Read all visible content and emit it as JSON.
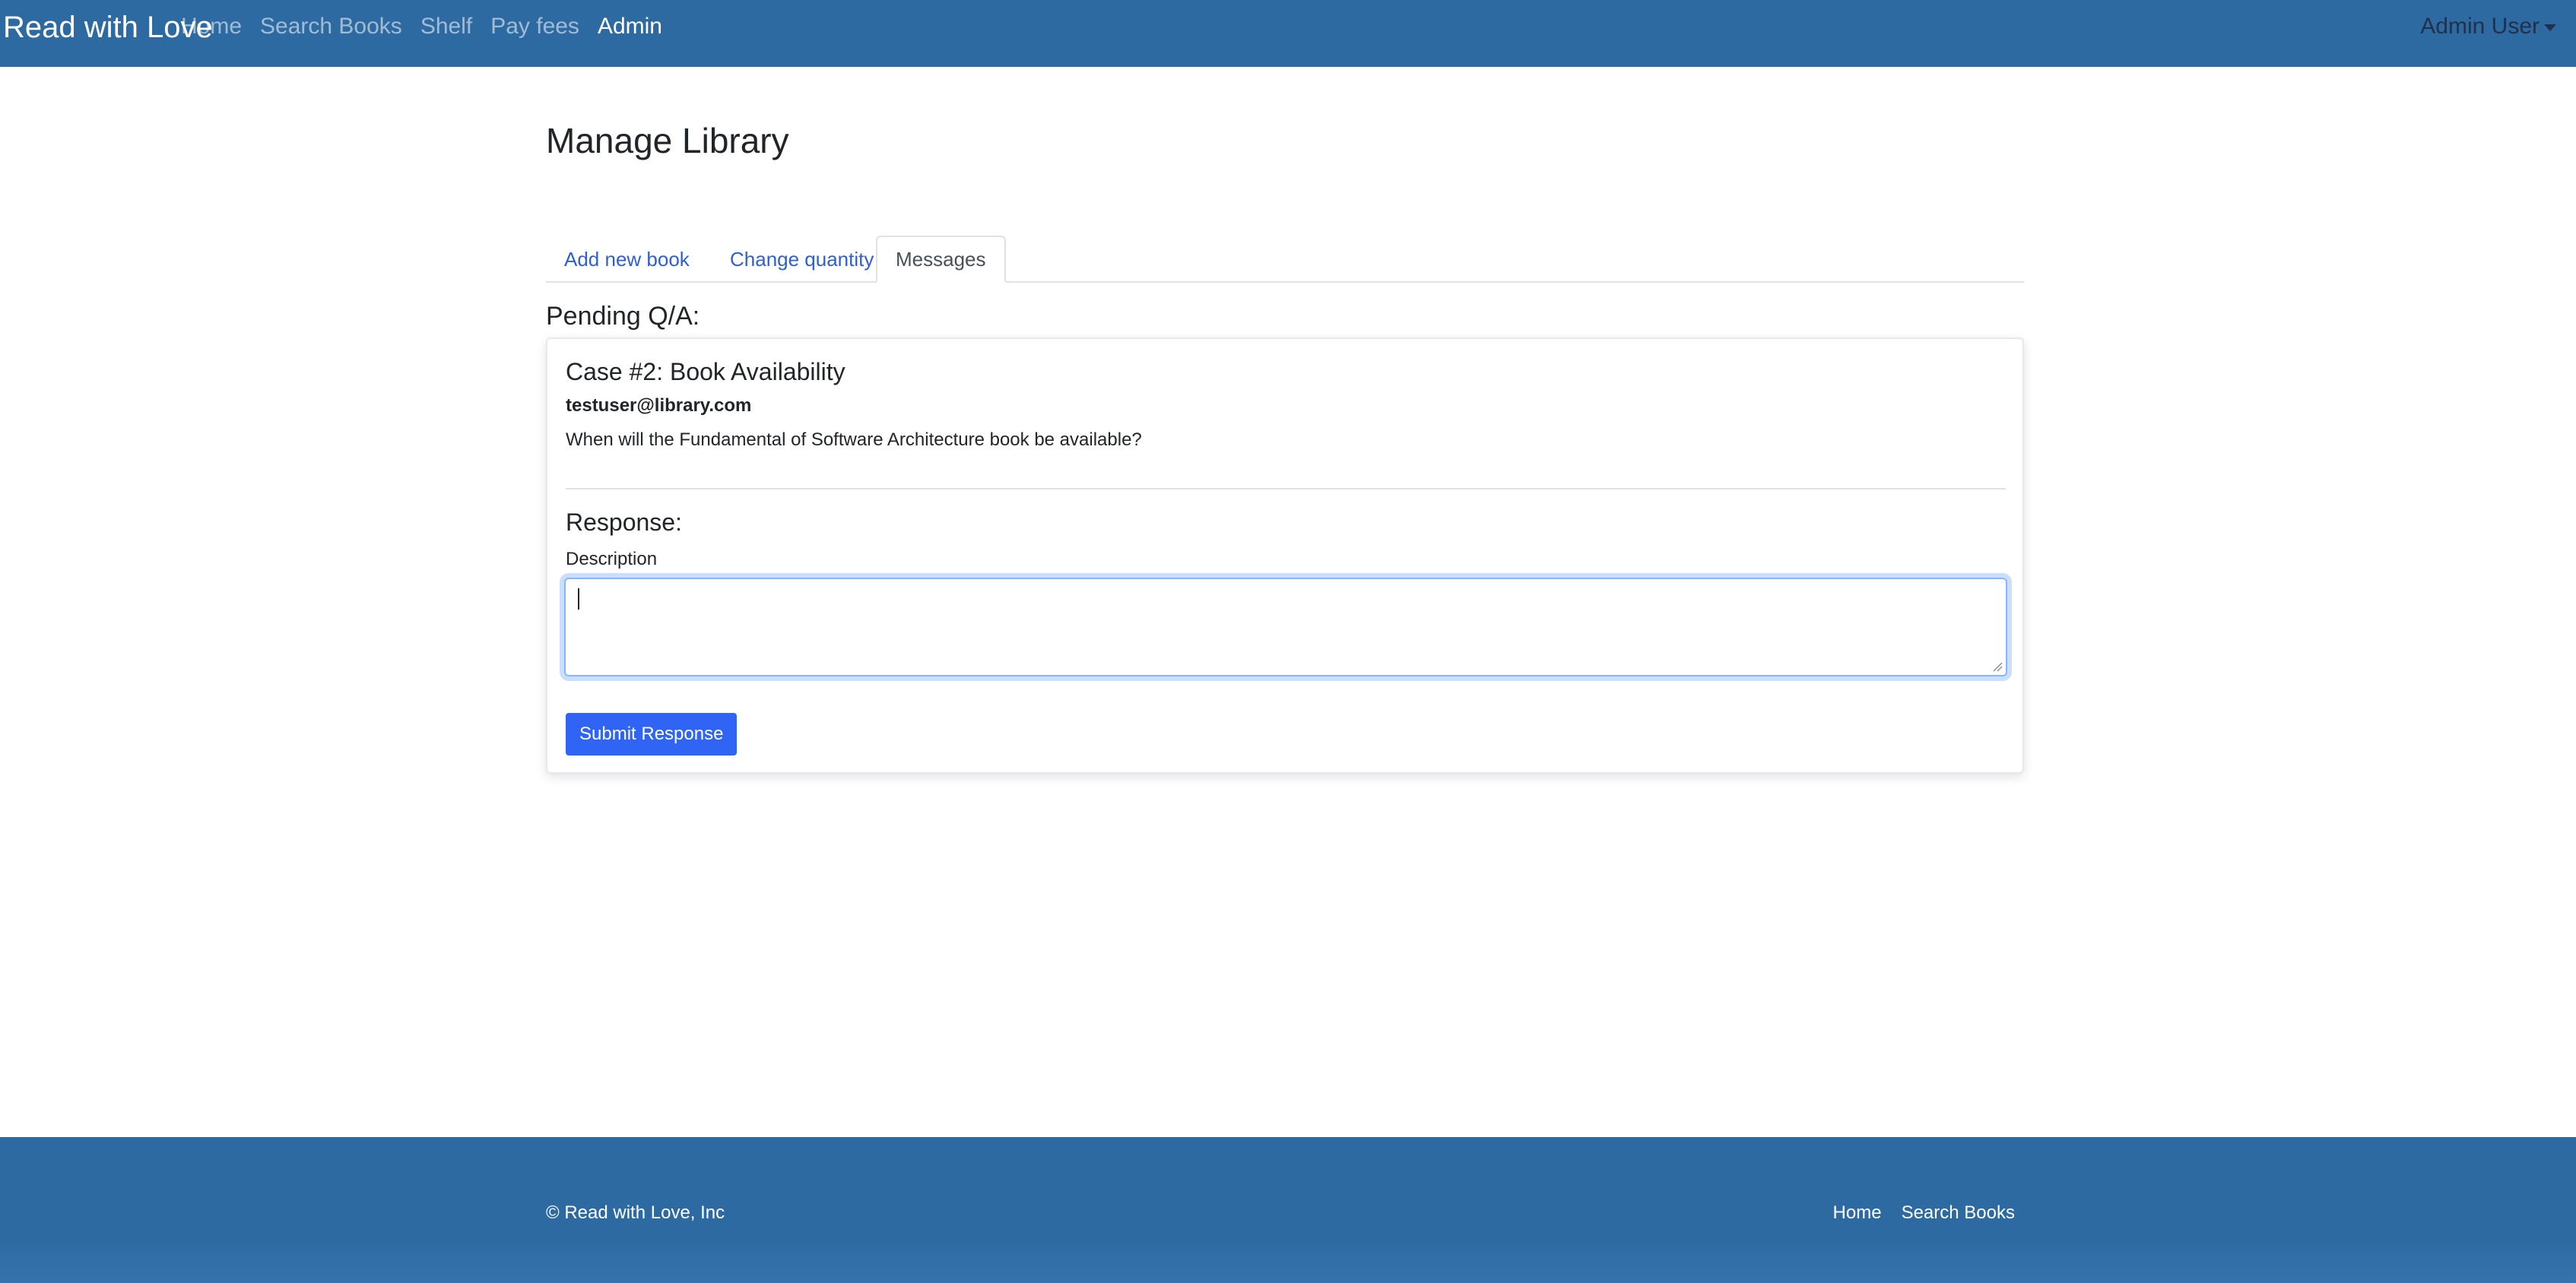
{
  "navbar": {
    "brand": "Read with Love",
    "links": [
      {
        "label": "Home",
        "active": false
      },
      {
        "label": "Search Books",
        "active": false
      },
      {
        "label": "Shelf",
        "active": false
      },
      {
        "label": "Pay fees",
        "active": false
      },
      {
        "label": "Admin",
        "active": true
      }
    ],
    "user_menu": "Admin User"
  },
  "main": {
    "title": "Manage Library",
    "tabs": [
      {
        "label": "Add new book",
        "active": false
      },
      {
        "label": "Change quantity",
        "active": false
      },
      {
        "label": "Messages",
        "active": true
      }
    ],
    "section_heading": "Pending Q/A:",
    "card": {
      "case_title": "Case #2: Book Availability",
      "email": "testuser@library.com",
      "question": "When will the Fundamental of Software Architecture book be available?",
      "response_heading": "Response:",
      "description_label": "Description",
      "description_value": "",
      "submit_label": "Submit Response"
    }
  },
  "footer": {
    "copyright": "© Read with Love, Inc",
    "links": [
      "Home",
      "Search Books"
    ]
  },
  "colors": {
    "navbar_bg": "#2e6aa2",
    "link_blue": "#2f5fd0",
    "primary_button": "#2f64f5"
  }
}
